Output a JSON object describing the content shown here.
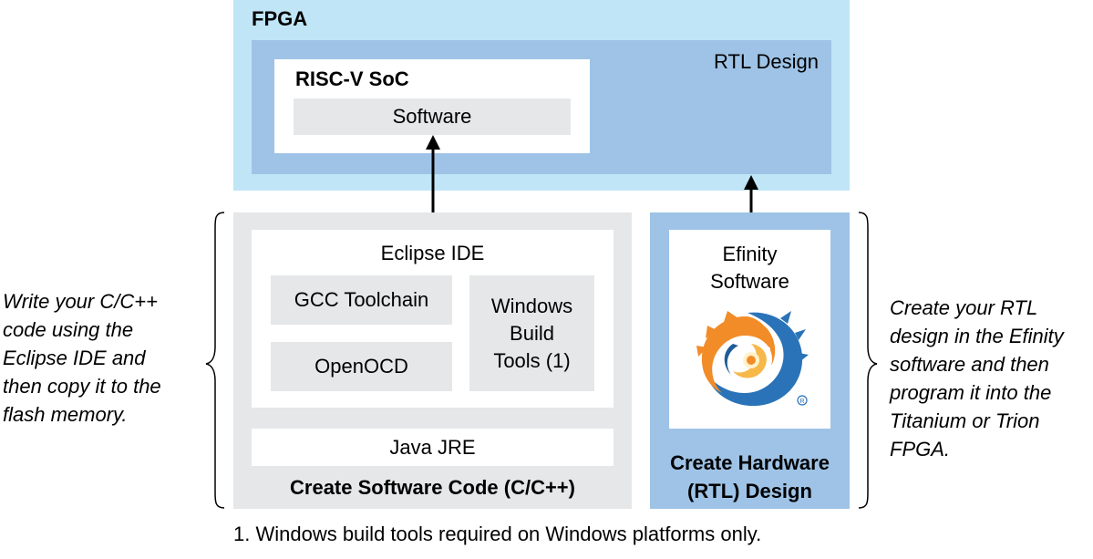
{
  "colors": {
    "fpga_background": "#bfe5f7",
    "rtl_background": "#9ec3e6",
    "software_panel": "#e6e7e8",
    "gray_box": "#e6e7e8",
    "hardware_panel": "#9ec3e6",
    "arrow": "#000000"
  },
  "fpga": {
    "title": "FPGA",
    "rtl_label": "RTL Design",
    "soc": {
      "title": "RISC-V SoC",
      "software_label": "Software"
    }
  },
  "software_panel": {
    "ide_label": "Eclipse IDE",
    "gcc_label": "GCC Toolchain",
    "openocd_label": "OpenOCD",
    "windows_build_label": "Windows\nBuild\nTools (1)",
    "jre_label": "Java JRE",
    "title": "Create Software Code (C/C++)"
  },
  "hardware_panel": {
    "software_label": "Efinity\nSoftware",
    "logo_icon": "efinity-logo-icon",
    "title": "Create Hardware\n(RTL) Design"
  },
  "notes": {
    "left": "Write your C/C++\ncode using the\nEclipse IDE and\nthen copy it to the\nflash memory.",
    "right": "Create your RTL\ndesign in the Efinity\nsoftware and then\nprogram it into the\nTitanium or Trion\nFPGA."
  },
  "footnote": "1. Windows build tools required on Windows platforms only."
}
